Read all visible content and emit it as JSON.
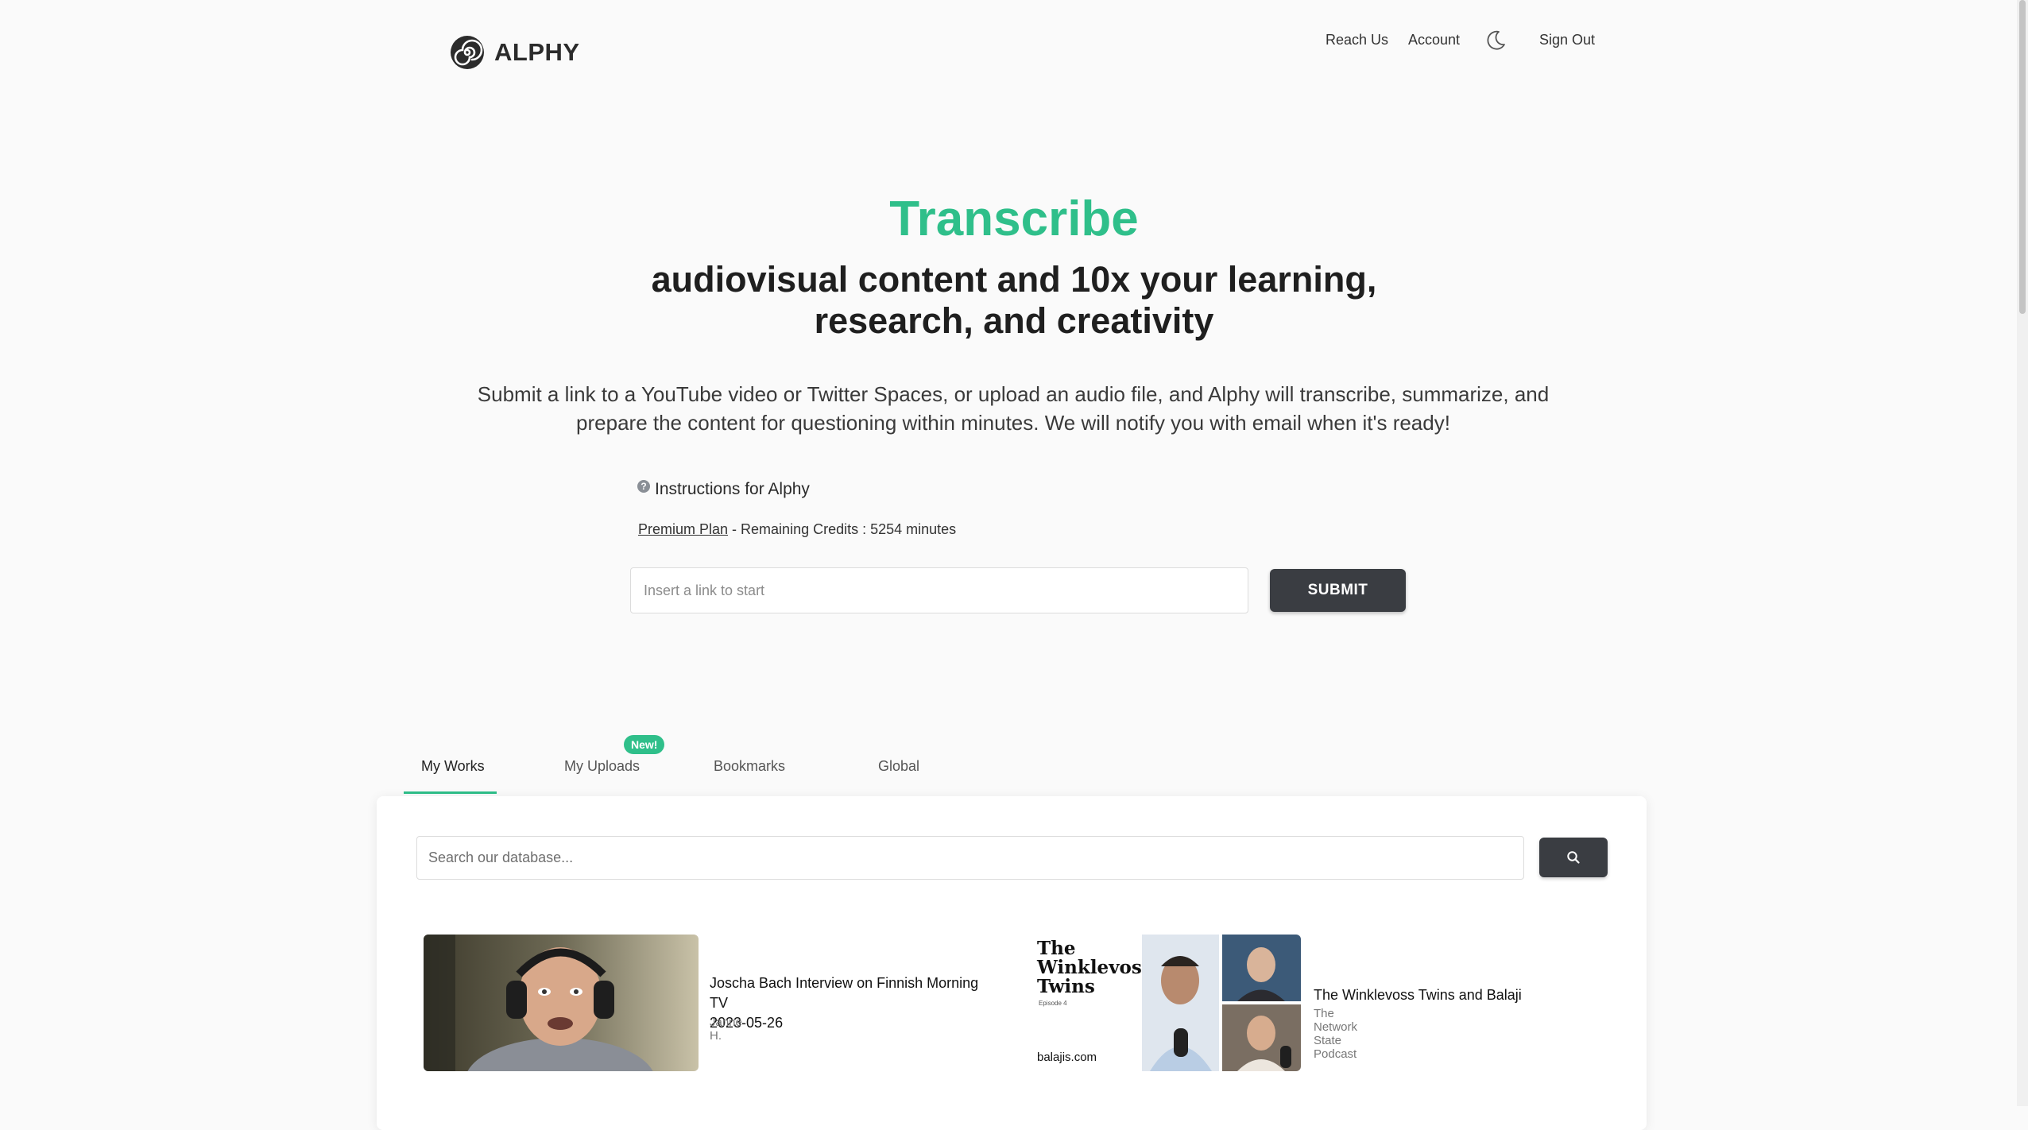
{
  "header": {
    "logo_text": "ALPHY",
    "nav": {
      "reach_us": "Reach Us",
      "account": "Account",
      "sign_out": "Sign Out"
    }
  },
  "hero": {
    "title": "Transcribe",
    "subtitle_line1": "audiovisual content and 10x your learning,",
    "subtitle_line2": "research, and creativity",
    "description_line1": "Submit a link to a YouTube video or Twitter Spaces, or upload an audio file, and Alphy will transcribe, summarize, and",
    "description_line2": "prepare the content for questioning within minutes. We will notify you with email when it's ready!"
  },
  "instructions": {
    "label": "Instructions for Alphy",
    "plan_link": "Premium Plan",
    "credits_text": " - Remaining Credits : 5254 minutes"
  },
  "link_form": {
    "placeholder": "Insert a link to start",
    "submit_label": "SUBMIT"
  },
  "tabs": {
    "my_works": "My Works",
    "my_uploads": "My Uploads",
    "new_badge": "New!",
    "bookmarks": "Bookmarks",
    "global": "Global",
    "active": "My Works"
  },
  "database": {
    "search_placeholder": "Search our database..."
  },
  "cards": [
    {
      "title_line1": "Joscha Bach Interview on Finnish Morning TV",
      "title_line2": "2023-05-26",
      "author": "Janne H."
    },
    {
      "title_line1": "The Winklevoss Twins and Balaji",
      "author": "The Network State Podcast",
      "thumb_heading_line1": "The",
      "thumb_heading_line2": "Winklevoss",
      "thumb_heading_line3": "Twins",
      "thumb_episode": "Episode 4",
      "thumb_site": "balajis.com"
    }
  ],
  "colors": {
    "accent": "#2fbf8a",
    "button_dark": "#3a3d42"
  }
}
